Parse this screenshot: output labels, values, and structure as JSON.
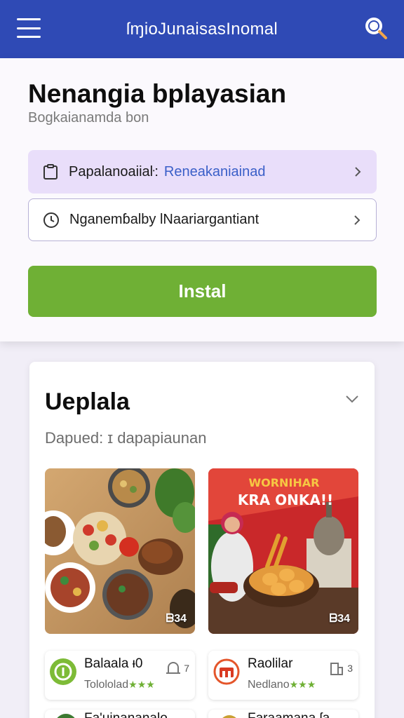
{
  "appbar": {
    "title": "ſɱioJunaisasInomal",
    "menu_icon": "hamburger-menu-icon",
    "search_icon": "search-icon"
  },
  "intro": {
    "headline": "Nenangia bplayasian",
    "subheading": "Bogkaianamda bon"
  },
  "rows": [
    {
      "icon": "clipboard-icon",
      "label": "Papalanoaiiaŀ:",
      "value": "Reneakaniainad"
    },
    {
      "icon": "clock-icon",
      "label": "Nganemɓalby ƖNaariargantiant",
      "value": ""
    }
  ],
  "install_button": {
    "label": "Instal",
    "color": "#6fb035"
  },
  "section": {
    "title": "Ueplala",
    "subtitle": "Dapued: ɪ dapapiaunan",
    "tiles": [
      {
        "name": "food-spread",
        "badge": "ᗷ34"
      },
      {
        "name": "promo-poster",
        "headline_1": "WORNIHAR",
        "headline_2": "KRA ONKA!!",
        "badge": "ᗷ34"
      }
    ],
    "cards": [
      {
        "name": "Balaala ᵻ0",
        "subtitle": "Tolololad",
        "stars": "★★★",
        "count": "7",
        "icon": "location-badge-icon"
      },
      {
        "name": "Raolilar",
        "subtitle": "Nedlano",
        "stars": "★★★",
        "count": "3",
        "icon": "store-icon"
      }
    ],
    "peek_cards": [
      {
        "name": "Fa'uinananalo"
      },
      {
        "name": "Faraamana ſa"
      }
    ]
  },
  "colors": {
    "appbar": "#2f4ab5",
    "accent_green": "#6fb035",
    "highlight_row": "#e9defa",
    "link_blue": "#3a5fc8"
  }
}
